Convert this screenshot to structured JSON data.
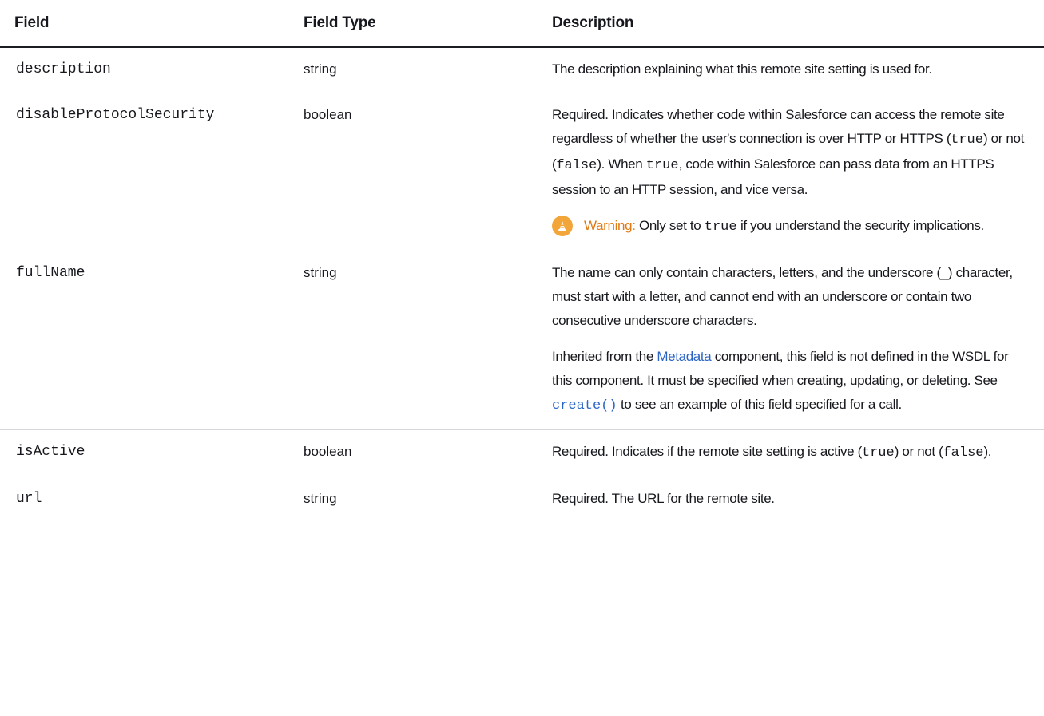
{
  "header": {
    "col_field": "Field",
    "col_type": "Field Type",
    "col_desc": "Description"
  },
  "rows": [
    {
      "field": "description",
      "type": "string",
      "desc": "The description explaining what this remote site setting is used for."
    },
    {
      "field": "disableProtocolSecurity",
      "type": "boolean",
      "desc_parts": [
        "Required. Indicates whether code within Salesforce can access the remote site regardless of whether the user's connection is over HTTP or HTTPS (",
        "true",
        ") or not (",
        "false",
        "). When ",
        "true",
        ", code within Salesforce can pass data from an HTTPS session to an HTTP session, and vice versa."
      ],
      "warning": {
        "label": "Warning:",
        "text_before": " Only set to ",
        "code": "true",
        "text_after": " if you understand the security implications.",
        "icon": "warning-cone-icon",
        "color": "#f2a63a",
        "label_color": "#e07b16"
      }
    },
    {
      "field": "fullName",
      "type": "string",
      "desc_p1": "The name can only contain characters, letters, and the underscore (_) character, must start with a letter, and cannot end with an underscore or contain two consecutive underscore characters.",
      "desc_p2_parts": [
        "Inherited from the ",
        "Metadata",
        " component, this field is not defined in the WSDL for this component. It must be specified when creating, updating, or deleting. See ",
        "create()",
        " to see an example of this field specified for a call."
      ]
    },
    {
      "field": "isActive",
      "type": "boolean",
      "desc_parts": [
        "Required. Indicates if the remote site setting is active (",
        "true",
        ") or not (",
        "false",
        ")."
      ]
    },
    {
      "field": "url",
      "type": "string",
      "desc": "Required. The URL for the remote site."
    }
  ],
  "colors": {
    "link": "#2a64c5",
    "text": "#16181d",
    "rule": "#d6d7da"
  }
}
